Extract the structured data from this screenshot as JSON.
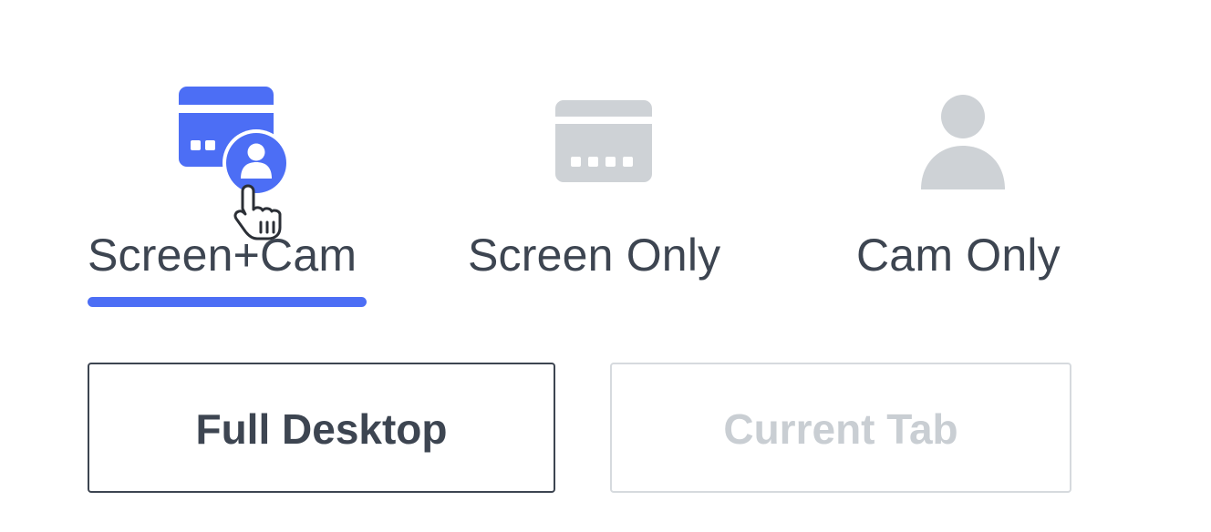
{
  "capture_modes": {
    "selected": "Screen+Cam",
    "items": [
      {
        "label": "Screen+Cam",
        "icon": "screen-cam-icon"
      },
      {
        "label": "Screen Only",
        "icon": "screen-icon"
      },
      {
        "label": "Cam Only",
        "icon": "person-icon"
      }
    ]
  },
  "sources": {
    "full_desktop": "Full Desktop",
    "current_tab": "Current Tab"
  },
  "colors": {
    "accent": "#4c6ef5",
    "inactive_icon": "#ced2d6",
    "text": "#3d4551",
    "disabled_text": "#c9ced3"
  }
}
